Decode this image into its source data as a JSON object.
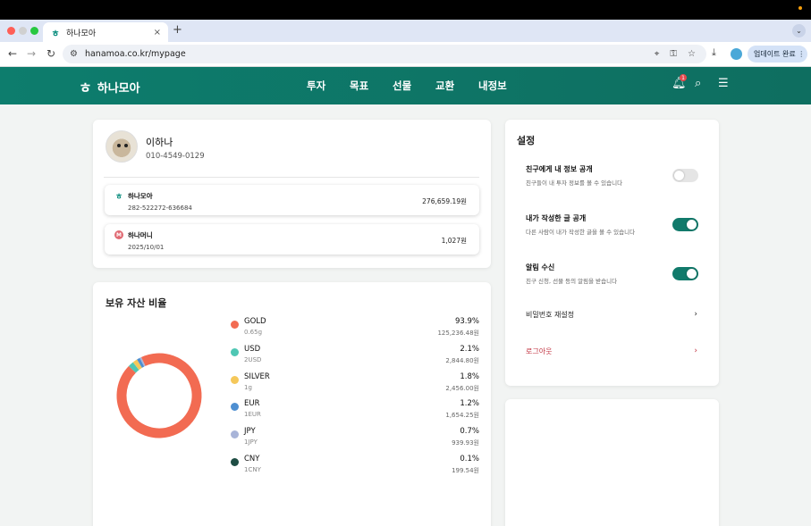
{
  "browser": {
    "tab_title": "하나모아",
    "tab_close": "×",
    "new_tab": "+",
    "url": "hanamoa.co.kr/mypage",
    "update_button": "업데이트 완료 ⋮"
  },
  "header": {
    "logo_mark": "ㅎ",
    "logo_text": "하나모아",
    "menu": [
      "투자",
      "목표",
      "선물",
      "교환",
      "내정보"
    ],
    "notification_count": "1"
  },
  "profile": {
    "name": "이하나",
    "phone": "010-4549-0129",
    "accounts": [
      {
        "name": "하나모아",
        "sub": "282-522272-636684",
        "amount": "276,659.19원"
      },
      {
        "name": "하나머니",
        "sub": "2025/10/01",
        "amount": "1,027원"
      }
    ]
  },
  "assets": {
    "title": "보유 자산 비율",
    "items": [
      {
        "name": "GOLD",
        "qty": "0.65g",
        "pct": "93.9%",
        "value": "125,236.48원",
        "color": "#f26b52"
      },
      {
        "name": "USD",
        "qty": "2USD",
        "pct": "2.1%",
        "value": "2,844.80원",
        "color": "#4fc7b4"
      },
      {
        "name": "SILVER",
        "qty": "1g",
        "pct": "1.8%",
        "value": "2,456.00원",
        "color": "#f5c85a"
      },
      {
        "name": "EUR",
        "qty": "1EUR",
        "pct": "1.2%",
        "value": "1,654.25원",
        "color": "#4e8fd1"
      },
      {
        "name": "JPY",
        "qty": "1JPY",
        "pct": "0.7%",
        "value": "939.93원",
        "color": "#a8b4d8"
      },
      {
        "name": "CNY",
        "qty": "1CNY",
        "pct": "0.1%",
        "value": "199.54원",
        "color": "#1f4d44"
      }
    ]
  },
  "chart_data": {
    "type": "pie",
    "categories": [
      "GOLD",
      "USD",
      "SILVER",
      "EUR",
      "JPY",
      "CNY"
    ],
    "values": [
      93.9,
      2.1,
      1.8,
      1.2,
      0.7,
      0.1
    ]
  },
  "settings": {
    "title": "설정",
    "toggles": [
      {
        "title": "친구에게 내 정보 공개",
        "desc": "친구들이 내 투자 정보를 볼 수 있습니다",
        "on": false
      },
      {
        "title": "내가 작성한 글 공개",
        "desc": "다른 사람이 내가 작성한 글을 볼 수 있습니다",
        "on": true
      },
      {
        "title": "알림 수신",
        "desc": "친구 신청, 선물 등의 알림을 받습니다",
        "on": true
      }
    ],
    "password_reset": "비밀번호 재설정",
    "logout": "로그아웃",
    "chevron": "›"
  }
}
